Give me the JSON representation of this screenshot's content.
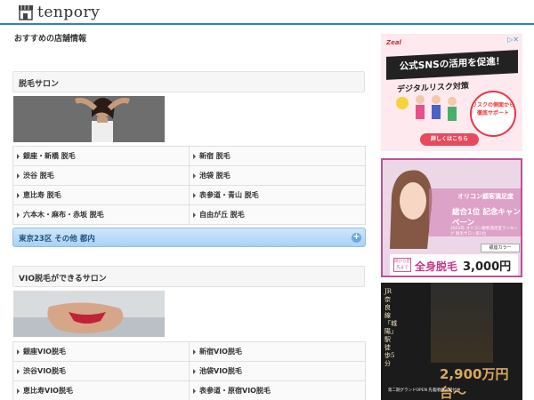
{
  "header": {
    "logo_text": "tenpory",
    "logo_icon": "store-icon",
    "accent_color": "#2f7fd0"
  },
  "main": {
    "page_title": "おすすめの店舗情報",
    "sections": [
      {
        "title": "脱毛サロン",
        "image": "woman-portrait-photo",
        "links": [
          "銀座・新橋 脱毛",
          "新宿 脱毛",
          "渋谷 脱毛",
          "池袋 脱毛",
          "恵比寿 脱毛",
          "表参道・青山 脱毛",
          "六本木・麻布・赤坂 脱毛",
          "自由が丘 脱毛"
        ],
        "region_link": "東京23区 その他 都内"
      },
      {
        "title": "VIO脱毛ができるサロン",
        "image": "bikini-beach-photo",
        "links": [
          "銀座VIO脱毛",
          "新宿VIO脱毛",
          "渋谷VIO脱毛",
          "池袋VIO脱毛",
          "恵比寿VIO脱毛",
          "表参道・原宿VIO脱毛"
        ]
      }
    ]
  },
  "sidebar": {
    "ad1": {
      "brand": "Zeal",
      "title": "公式SNSの活用を促進！",
      "subtitle": "デジタルリスク対策",
      "circle_text": "リスクの側面から徹底サポート",
      "button": "詳しくはこちら"
    },
    "ad2": {
      "line1": "オリコン顧客満足度",
      "line2": "総合1位 記念キャンペーン",
      "line3": "2021年 オリコン顧客満足度ランキング 脱毛サロン第1位",
      "shop": "銀座カラー",
      "tag": "顔から足先まで",
      "price_label": "全身脱毛",
      "price": "3,000円"
    },
    "ad3": {
      "vertical_text": "JR奈良線「城陽」駅徒歩5分",
      "price": "2,900万円台〜",
      "footer": "第二期グランドOPEN 先着順申込受付中"
    }
  }
}
